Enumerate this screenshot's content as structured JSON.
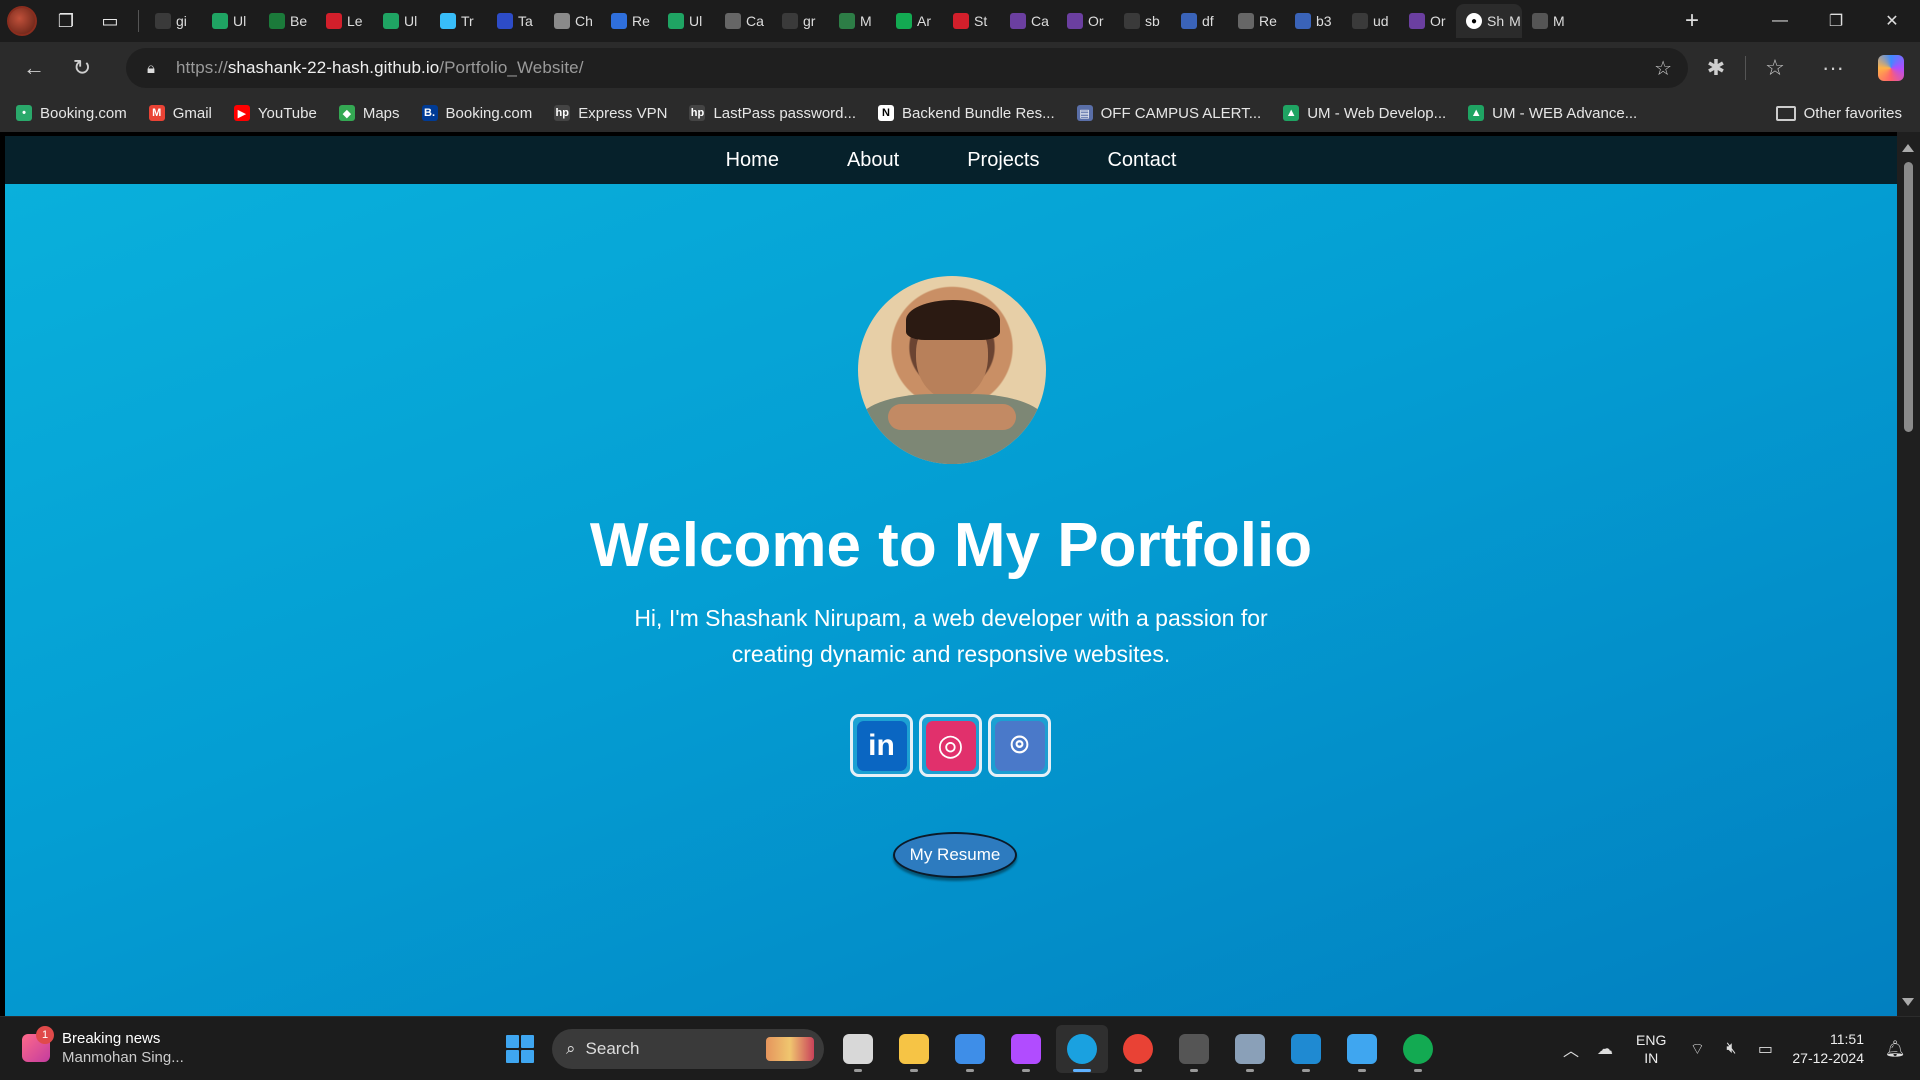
{
  "browser": {
    "tabs": [
      {
        "label": "gi",
        "fav": "magnifier-icon",
        "color": "#3a3a3a"
      },
      {
        "label": "Ul",
        "fav": "google-drive-icon",
        "color": "#1fa463"
      },
      {
        "label": "Be",
        "fav": "n-logo-icon",
        "color": "#1b7a3a"
      },
      {
        "label": "Le",
        "fav": "youtube-icon",
        "color": "#d21f2b"
      },
      {
        "label": "Ul",
        "fav": "google-drive-icon",
        "color": "#1fa463"
      },
      {
        "label": "Tr",
        "fav": "tailwind-icon",
        "color": "#38bdf8"
      },
      {
        "label": "Ta",
        "fav": "circle-logo-icon",
        "color": "#2d4cc7"
      },
      {
        "label": "Ch",
        "fav": "chatgpt-icon",
        "color": "#8a8a8a"
      },
      {
        "label": "Re",
        "fav": "flag-icon",
        "color": "#2f6fdc"
      },
      {
        "label": "Ul",
        "fav": "google-drive-icon",
        "color": "#1fa463"
      },
      {
        "label": "Ca",
        "fav": "globe-icon",
        "color": "#666"
      },
      {
        "label": "gr",
        "fav": "magnifier-icon",
        "color": "#3a3a3a"
      },
      {
        "label": "M",
        "fav": "leaf-icon",
        "color": "#2d7d46"
      },
      {
        "label": "Ar",
        "fav": "mongodb-icon",
        "color": "#13aa52"
      },
      {
        "label": "St",
        "fav": "youtube-icon",
        "color": "#d21f2b"
      },
      {
        "label": "Ca",
        "fav": "u-logo-icon",
        "color": "#6b3fa0"
      },
      {
        "label": "Or",
        "fav": "u-logo-icon",
        "color": "#6b3fa0"
      },
      {
        "label": "sb",
        "fav": "magnifier-icon",
        "color": "#3a3a3a"
      },
      {
        "label": "df",
        "fav": "arrow-up-icon",
        "color": "#3a63b8"
      },
      {
        "label": "Re",
        "fav": "globe-icon",
        "color": "#666"
      },
      {
        "label": "b3",
        "fav": "arrow-up-icon",
        "color": "#3a63b8"
      },
      {
        "label": "ud",
        "fav": "magnifier-icon",
        "color": "#3a3a3a"
      },
      {
        "label": "Or",
        "fav": "u-logo-icon",
        "color": "#6b3fa0"
      }
    ],
    "active_tab": {
      "label": "Sh",
      "extra": "M",
      "fav": "github-icon"
    },
    "after_tab": {
      "label": "M",
      "fav": "globe-icon"
    },
    "url_scheme": "https://",
    "url_host": "shashank-22-hash.github.io",
    "url_path": "/Portfolio_Website/",
    "bookmarks": [
      {
        "label": "Booking.com",
        "icon": "booking-dot-icon",
        "color": "#2aa96b",
        "glyph": "•"
      },
      {
        "label": "Gmail",
        "icon": "gmail-icon",
        "color": "#ea4335",
        "glyph": "M"
      },
      {
        "label": "YouTube",
        "icon": "youtube-icon",
        "color": "#ff0000",
        "glyph": "▶"
      },
      {
        "label": "Maps",
        "icon": "maps-pin-icon",
        "color": "#34a853",
        "glyph": "◆"
      },
      {
        "label": "Booking.com",
        "icon": "booking-b-icon",
        "color": "#003b95",
        "glyph": "B."
      },
      {
        "label": "Express VPN",
        "icon": "hp-icon",
        "color": "#444",
        "glyph": "hp"
      },
      {
        "label": "LastPass password...",
        "icon": "hp-icon",
        "color": "#444",
        "glyph": "hp"
      },
      {
        "label": "Backend Bundle Res...",
        "icon": "notion-icon",
        "color": "#fff",
        "glyph": "N"
      },
      {
        "label": "OFF CAMPUS ALERT...",
        "icon": "news-icon",
        "color": "#5a6fa8",
        "glyph": "▤"
      },
      {
        "label": "UM - Web Develop...",
        "icon": "google-drive-icon",
        "color": "#1fa463",
        "glyph": "▲"
      },
      {
        "label": "UM - WEB Advance...",
        "icon": "google-drive-icon",
        "color": "#1fa463",
        "glyph": "▲"
      }
    ],
    "other_favorites": "Other favorites"
  },
  "site": {
    "nav": [
      "Home",
      "About",
      "Projects",
      "Contact"
    ],
    "title": "Welcome to My Portfolio",
    "intro": "Hi, I'm Shashank Nirupam, a web developer with a passion for creating dynamic and responsive websites.",
    "social": [
      {
        "name": "linkedin-icon",
        "glyph": "in",
        "color": "#0a66c2"
      },
      {
        "name": "instagram-icon",
        "glyph": "◎",
        "color": "#e1306c"
      },
      {
        "name": "github-icon",
        "glyph": "⌾",
        "color": "#4a79c9"
      }
    ],
    "resume_label": "My Resume",
    "colors": {
      "nav_bg": "#06212b",
      "hero_top": "#0ab1dc",
      "hero_bottom": "#0280c0",
      "button": "#2d7bbf"
    }
  },
  "taskbar": {
    "news_title": "Breaking news",
    "news_sub": "Manmohan Sing...",
    "news_badge": "1",
    "search_placeholder": "Search",
    "apps": [
      {
        "name": "task-view-icon",
        "color": "#d8d8d8"
      },
      {
        "name": "file-explorer-icon",
        "color": "#f6c445"
      },
      {
        "name": "microsoft-store-icon",
        "color": "#3e8ee8"
      },
      {
        "name": "copilot-icon",
        "color": "#b14cff"
      },
      {
        "name": "edge-icon",
        "color": "#1aa1e0",
        "active": true
      },
      {
        "name": "chrome-icon",
        "color": "#e94235"
      },
      {
        "name": "terminal-icon",
        "color": "#555"
      },
      {
        "name": "settings-icon",
        "color": "#8aa0b8"
      },
      {
        "name": "vscode-icon",
        "color": "#1f8ad2"
      },
      {
        "name": "notepad-icon",
        "color": "#3fa6f0"
      },
      {
        "name": "mongodb-compass-icon",
        "color": "#13aa52"
      }
    ],
    "lang_top": "ENG",
    "lang_bottom": "IN",
    "time": "11:51",
    "date": "27-12-2024"
  }
}
